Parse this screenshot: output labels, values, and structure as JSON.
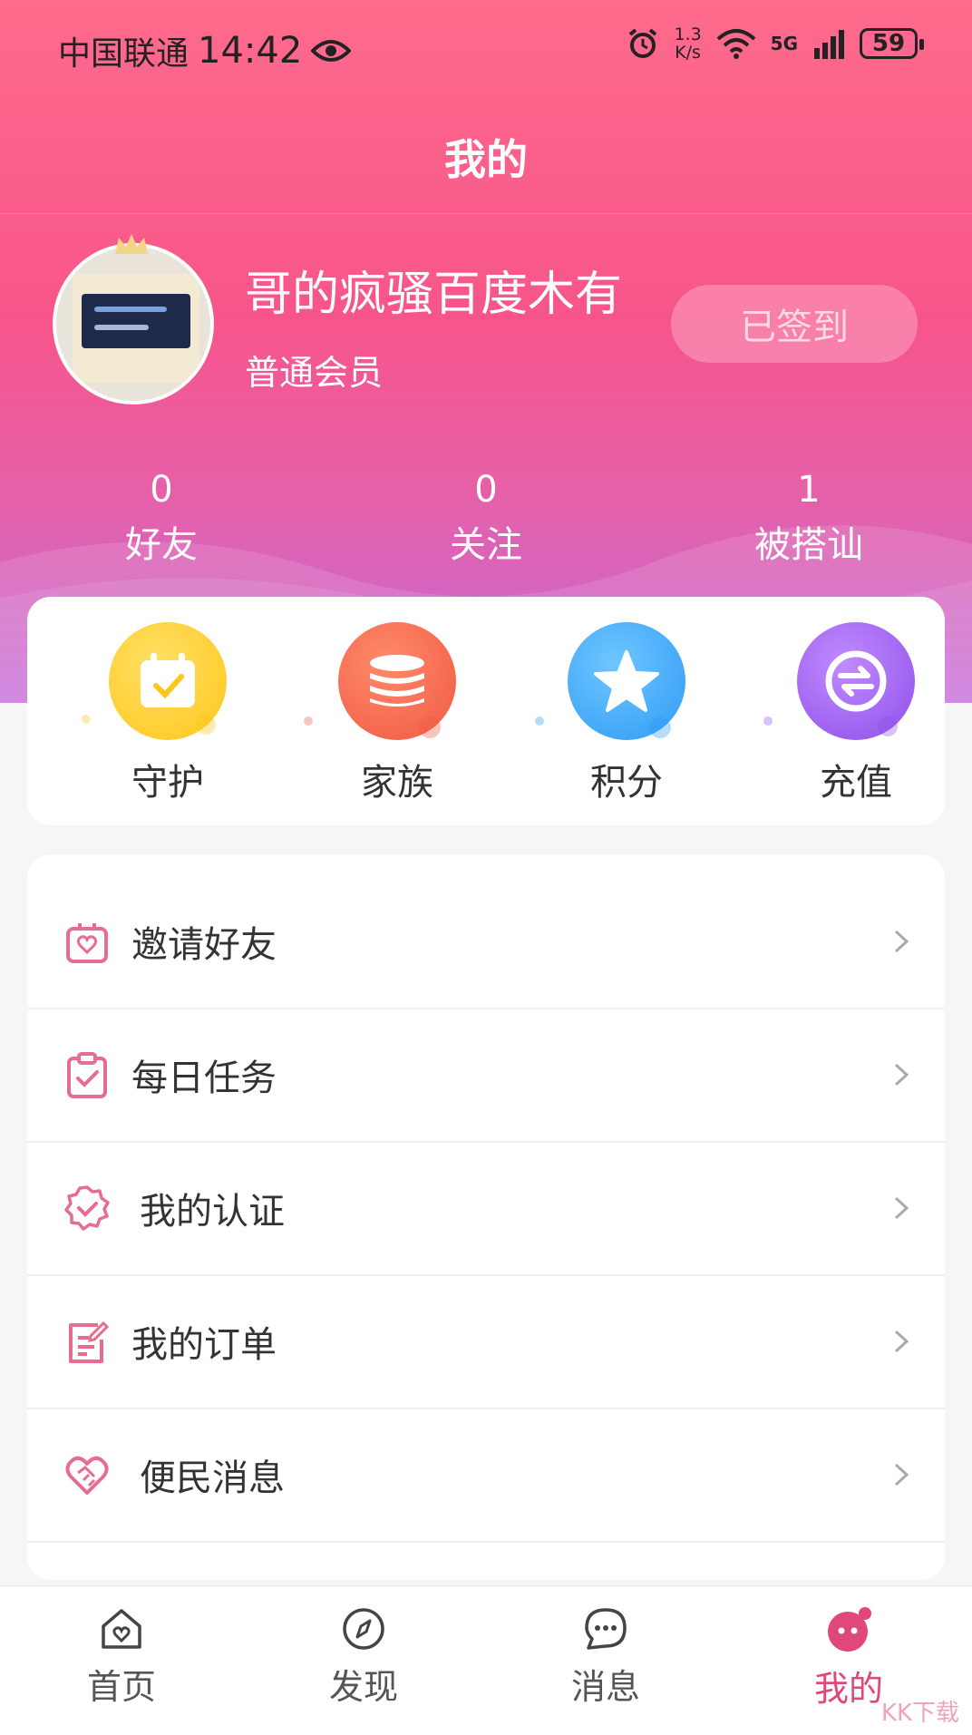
{
  "status_bar": {
    "carrier": "中国联通",
    "time": "14:42",
    "speed_value": "1.3",
    "speed_unit": "K/s",
    "network": "5G",
    "battery": "59"
  },
  "header": {
    "title": "我的"
  },
  "profile": {
    "username": "哥的疯骚百度木有",
    "level": "普通会员",
    "sign_button": "已签到"
  },
  "stats": [
    {
      "value": "0",
      "label": "好友"
    },
    {
      "value": "0",
      "label": "关注"
    },
    {
      "value": "1",
      "label": "被搭讪"
    }
  ],
  "quick_actions": [
    {
      "label": "守护",
      "icon": "calendar-check-icon",
      "color": "#ffc61a"
    },
    {
      "label": "家族",
      "icon": "coin-stack-icon",
      "color": "#f4664c"
    },
    {
      "label": "积分",
      "icon": "star-icon",
      "color": "#2f9bf5"
    },
    {
      "label": "充值",
      "icon": "recharge-icon",
      "color": "#9b5cf0"
    }
  ],
  "menu": [
    {
      "label": "邀请好友",
      "icon": "gift-heart-icon"
    },
    {
      "label": "每日任务",
      "icon": "clipboard-check-icon"
    },
    {
      "label": "我的认证",
      "icon": "verified-badge-icon"
    },
    {
      "label": "我的订单",
      "icon": "order-edit-icon"
    },
    {
      "label": "便民消息",
      "icon": "handshake-heart-icon"
    }
  ],
  "tabs": [
    {
      "label": "首页",
      "icon": "home-heart-icon",
      "active": false
    },
    {
      "label": "发现",
      "icon": "compass-icon",
      "active": false
    },
    {
      "label": "消息",
      "icon": "chat-bubble-icon",
      "active": false
    },
    {
      "label": "我的",
      "icon": "profile-face-icon",
      "active": true
    }
  ],
  "watermark": "KK下载",
  "colors": {
    "primary": "#ff5b8a",
    "accent_purple": "#c46ad9",
    "active_tab": "#e0487a",
    "menu_icon": "#e76d8f"
  }
}
